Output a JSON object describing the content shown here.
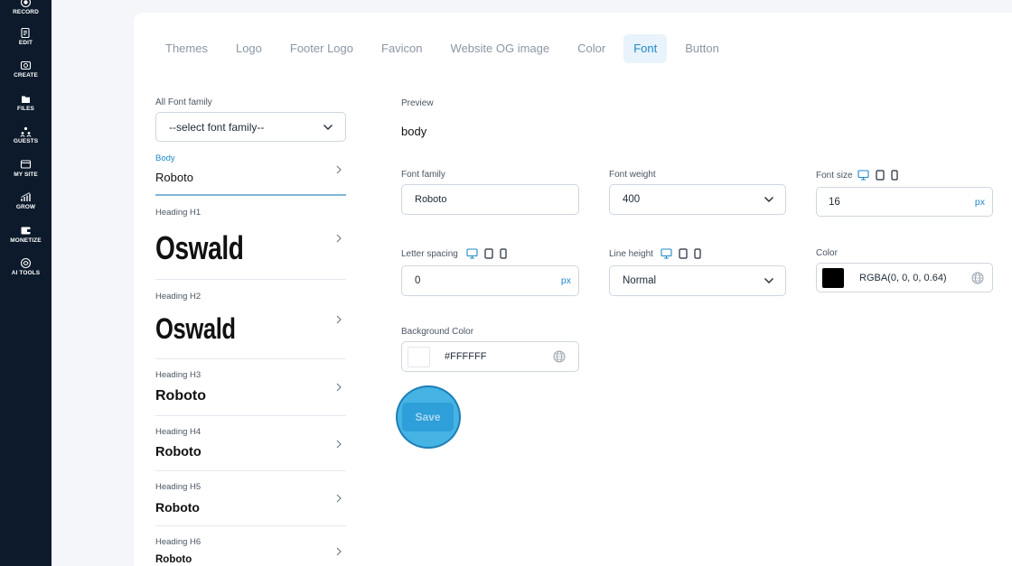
{
  "sidebar": {
    "items": [
      {
        "label": "RECORD",
        "icon": "record-icon"
      },
      {
        "label": "EDIT",
        "icon": "edit-icon"
      },
      {
        "label": "CREATE",
        "icon": "create-icon"
      },
      {
        "label": "FILES",
        "icon": "files-icon"
      },
      {
        "label": "GUESTS",
        "icon": "guests-icon"
      },
      {
        "label": "MY SITE",
        "icon": "my-site-icon"
      },
      {
        "label": "GROW",
        "icon": "grow-icon"
      },
      {
        "label": "MONETIZE",
        "icon": "monetize-icon"
      },
      {
        "label": "AI TOOLS",
        "icon": "ai-tools-icon"
      }
    ]
  },
  "tabs": [
    {
      "label": "Themes"
    },
    {
      "label": "Logo"
    },
    {
      "label": "Footer Logo"
    },
    {
      "label": "Favicon"
    },
    {
      "label": "Website OG image"
    },
    {
      "label": "Color"
    },
    {
      "label": "Font",
      "active": true
    },
    {
      "label": "Button"
    }
  ],
  "font_list": {
    "all_family_label": "All Font family",
    "all_family_placeholder": "--select font family--",
    "items": [
      {
        "label": "Body",
        "value": "Roboto",
        "active": true
      },
      {
        "label": "Heading H1",
        "value": "Oswald"
      },
      {
        "label": "Heading H2",
        "value": "Oswald"
      },
      {
        "label": "Heading H3",
        "value": "Roboto"
      },
      {
        "label": "Heading H4",
        "value": "Roboto"
      },
      {
        "label": "Heading H5",
        "value": "Roboto"
      },
      {
        "label": "Heading H6",
        "value": "Roboto"
      }
    ]
  },
  "preview": {
    "label": "Preview",
    "text": "body"
  },
  "fields": {
    "font_family": {
      "label": "Font family",
      "value": "Roboto"
    },
    "font_weight": {
      "label": "Font weight",
      "value": "400"
    },
    "font_size": {
      "label": "Font size",
      "value": "16",
      "unit": "px"
    },
    "letter_spacing": {
      "label": "Letter spacing",
      "value": "0",
      "unit": "px"
    },
    "line_height": {
      "label": "Line height",
      "value": "Normal"
    },
    "color": {
      "label": "Color",
      "value": "RGBA(0, 0, 0, 0.64)",
      "swatch": "#000000"
    },
    "background_color": {
      "label": "Background Color",
      "value": "#FFFFFF",
      "swatch": "#ffffff"
    }
  },
  "save_label": "Save",
  "colors": {
    "accent": "#1e88c8",
    "sidebar_bg": "#0c1a2b",
    "active_tab_bg": "#e8f3fb",
    "save_button": "#2e9fd8"
  }
}
